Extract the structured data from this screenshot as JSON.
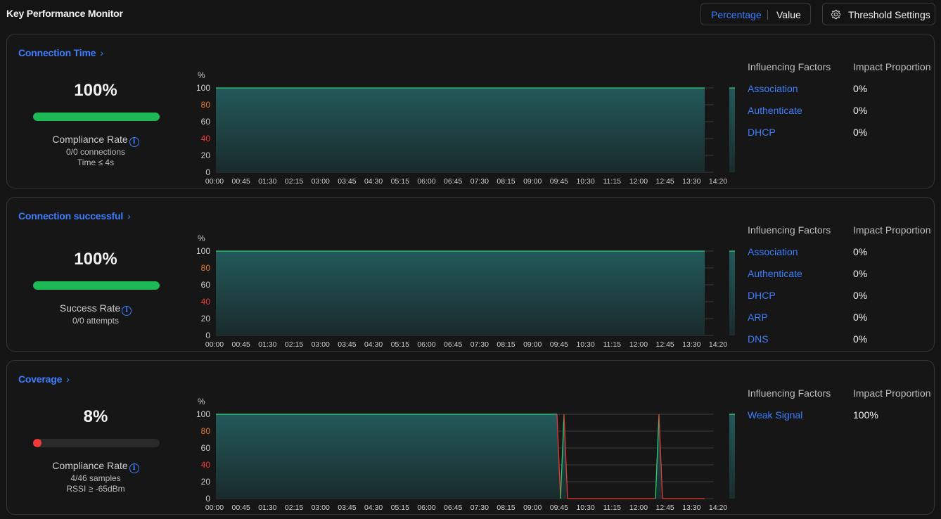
{
  "header": {
    "title": "Key Performance Monitor",
    "toggle": {
      "option_a": "Percentage",
      "option_b": "Value",
      "selected": "Percentage"
    },
    "threshold_label": "Threshold Settings"
  },
  "colors": {
    "accent": "#3d7eff",
    "good": "#1db954",
    "bad": "#f03a3a",
    "warn_tick": "#e0782a",
    "area_top": "#22595a",
    "area_bottom": "#1a2b2c",
    "good_line": "#2ecc71",
    "bad_line": "#e53935"
  },
  "cards": [
    {
      "title": "Connection Time",
      "value": "100%",
      "progress": 1.0,
      "status": "good",
      "rate_label": "Compliance Rate",
      "sub_lines": [
        "0/0 connections",
        "Time ≤ 4s"
      ],
      "factors_header": [
        "Influencing Factors",
        "Impact Proportion"
      ],
      "factors": [
        {
          "name": "Association",
          "value": "0%"
        },
        {
          "name": "Authenticate",
          "value": "0%"
        },
        {
          "name": "DHCP",
          "value": "0%"
        }
      ]
    },
    {
      "title": "Connection successful",
      "value": "100%",
      "progress": 1.0,
      "status": "good",
      "rate_label": "Success Rate",
      "sub_lines": [
        "0/0 attempts"
      ],
      "factors_header": [
        "Influencing Factors",
        "Impact Proportion"
      ],
      "factors": [
        {
          "name": "Association",
          "value": "0%"
        },
        {
          "name": "Authenticate",
          "value": "0%"
        },
        {
          "name": "DHCP",
          "value": "0%"
        },
        {
          "name": "ARP",
          "value": "0%"
        },
        {
          "name": "DNS",
          "value": "0%"
        }
      ]
    },
    {
      "title": "Coverage",
      "value": "8%",
      "progress": 0.0,
      "status": "bad",
      "rate_label": "Compliance Rate",
      "sub_lines": [
        "4/46 samples",
        "RSSI ≥ -65dBm"
      ],
      "factors_header": [
        "Influencing Factors",
        "Impact Proportion"
      ],
      "factors": [
        {
          "name": "Weak Signal",
          "value": "100%"
        }
      ]
    }
  ],
  "chart_data": [
    {
      "type": "area",
      "ylabel": "%",
      "ylim": [
        0,
        100
      ],
      "yticks": [
        0,
        20,
        40,
        60,
        80,
        100
      ],
      "ytick_colors": {
        "80": "warn",
        "40": "bad"
      },
      "xticks": [
        "00:00",
        "00:45",
        "01:30",
        "02:15",
        "03:00",
        "03:45",
        "04:30",
        "05:15",
        "06:00",
        "06:45",
        "07:30",
        "08:15",
        "09:00",
        "09:45",
        "10:30",
        "11:15",
        "12:00",
        "12:45",
        "13:30",
        "14:20"
      ],
      "segments": [
        {
          "x": [
            0,
            695
          ],
          "y": [
            100,
            100
          ]
        },
        {
          "x": [
            730,
            860
          ],
          "y": [
            100,
            100
          ]
        }
      ]
    },
    {
      "type": "area",
      "ylabel": "%",
      "ylim": [
        0,
        100
      ],
      "yticks": [
        0,
        20,
        40,
        60,
        80,
        100
      ],
      "ytick_colors": {
        "80": "warn",
        "40": "bad"
      },
      "xticks": [
        "00:00",
        "00:45",
        "01:30",
        "02:15",
        "03:00",
        "03:45",
        "04:30",
        "05:15",
        "06:00",
        "06:45",
        "07:30",
        "08:15",
        "09:00",
        "09:45",
        "10:30",
        "11:15",
        "12:00",
        "12:45",
        "13:30",
        "14:20"
      ],
      "segments": [
        {
          "x": [
            0,
            695
          ],
          "y": [
            100,
            100
          ]
        },
        {
          "x": [
            730,
            860
          ],
          "y": [
            100,
            100
          ]
        }
      ]
    },
    {
      "type": "area",
      "ylabel": "%",
      "ylim": [
        0,
        100
      ],
      "yticks": [
        0,
        20,
        40,
        60,
        80,
        100
      ],
      "ytick_colors": {
        "80": "warn",
        "40": "bad"
      },
      "xticks": [
        "00:00",
        "00:45",
        "01:30",
        "02:15",
        "03:00",
        "03:45",
        "04:30",
        "05:15",
        "06:00",
        "06:45",
        "07:30",
        "08:15",
        "09:00",
        "09:45",
        "10:30",
        "11:15",
        "12:00",
        "12:45",
        "13:30",
        "14:20"
      ],
      "segments": [
        {
          "x": [
            0,
            485,
            490,
            495,
            500,
            625,
            630,
            635,
            695
          ],
          "y": [
            100,
            100,
            0,
            100,
            0,
            0,
            100,
            0,
            0
          ]
        },
        {
          "x": [
            730,
            780,
            785,
            790,
            860
          ],
          "y": [
            100,
            100,
            0,
            100,
            100
          ]
        }
      ]
    }
  ]
}
